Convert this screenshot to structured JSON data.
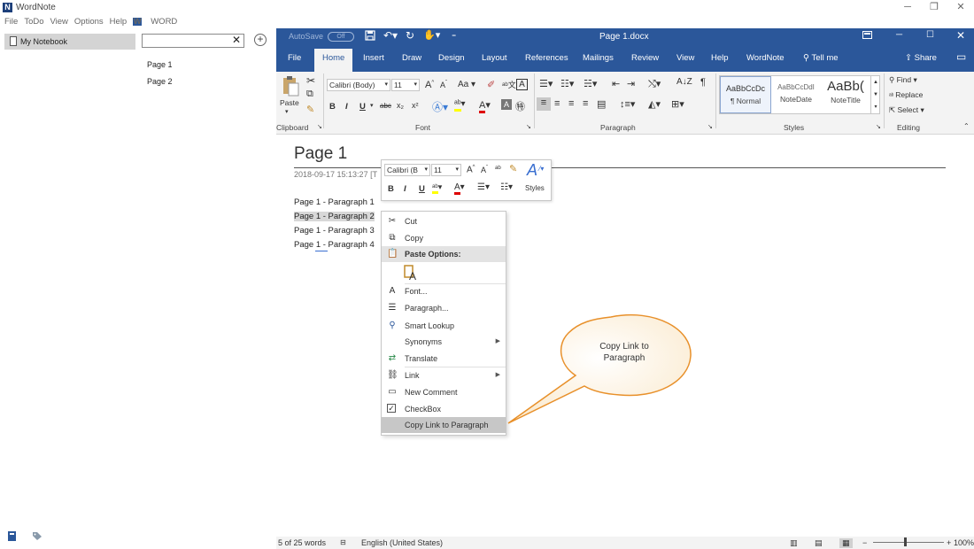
{
  "app": {
    "logo_letter": "N",
    "title": "WordNote",
    "menu": [
      "File",
      "ToDo",
      "View",
      "Options",
      "Help"
    ],
    "word_menu_label": "WORD",
    "word_menu_icon_letter": "W"
  },
  "sidebar": {
    "notebook_label": "My Notebook",
    "search_value": "",
    "search_clear_glyph": "✕",
    "add_glyph": "+",
    "pages": [
      "Page 1",
      "Page 2"
    ]
  },
  "word": {
    "autosave_label": "AutoSave",
    "autosave_state": "Off",
    "doc_title": "Page 1.docx",
    "tabs": [
      "File",
      "Home",
      "Insert",
      "Draw",
      "Design",
      "Layout",
      "References",
      "Mailings",
      "Review",
      "View",
      "Help",
      "WordNote"
    ],
    "active_tab": "Home",
    "tell_me": "Tell me",
    "share": "Share"
  },
  "ribbon": {
    "paste_label": "Paste",
    "clipboard_label": "Clipboard",
    "font_name": "Calibri (Body)",
    "font_size": "11",
    "font_label": "Font",
    "paragraph_label": "Paragraph",
    "styles_label": "Styles",
    "editing_label": "Editing",
    "bold": "B",
    "italic": "I",
    "underline": "U",
    "strike": "abc",
    "subscript": "x₂",
    "superscript": "x²",
    "case": "Aa",
    "grow": "A",
    "shrink": "A",
    "styles": [
      {
        "preview": "AaBbCcDc",
        "name": "¶ Normal"
      },
      {
        "preview": "AaBbCcDdI",
        "name": "NoteDate"
      },
      {
        "preview": "AaBb(",
        "name": "NoteTitle"
      }
    ],
    "find": "Find",
    "replace": "Replace",
    "select": "Select"
  },
  "document": {
    "title": "Page 1",
    "date": "2018-09-17 15:13:27  [T",
    "paragraphs": [
      "Page 1  - Paragraph 1",
      "Page 1  - Paragraph 2",
      "Page 1  - Paragraph 3",
      "Page 1  - Paragraph 4"
    ],
    "selected_index": 1
  },
  "mini_toolbar": {
    "font_name": "Calibri (B",
    "font_size": "11",
    "styles_label": "Styles"
  },
  "context_menu": {
    "items": [
      {
        "label": "Cut",
        "icon": "scissors-icon"
      },
      {
        "label": "Copy",
        "icon": "copy-icon"
      },
      {
        "label": "Paste Options:",
        "icon": "paste-icon"
      },
      {
        "label": "Font...",
        "icon": "font-icon"
      },
      {
        "label": "Paragraph...",
        "icon": "paragraph-icon"
      },
      {
        "label": "Smart Lookup",
        "icon": "search-icon"
      },
      {
        "label": "Synonyms",
        "icon": ""
      },
      {
        "label": "Translate",
        "icon": "translate-icon"
      },
      {
        "label": "Link",
        "icon": "link-icon"
      },
      {
        "label": "New Comment",
        "icon": "comment-icon"
      },
      {
        "label": "CheckBox",
        "icon": "checkbox-icon"
      },
      {
        "label": "Copy Link to Paragraph",
        "icon": ""
      }
    ],
    "highlighted": "Copy Link to Paragraph"
  },
  "callout": {
    "line1": "Copy Link to",
    "line2": "Paragraph"
  },
  "status": {
    "word_count": "5 of 25 words",
    "language": "English (United States)",
    "zoom": "100%"
  },
  "colors": {
    "word_blue": "#2b579a",
    "callout_fill": "#fff7e8",
    "callout_stroke": "#e8902a"
  }
}
